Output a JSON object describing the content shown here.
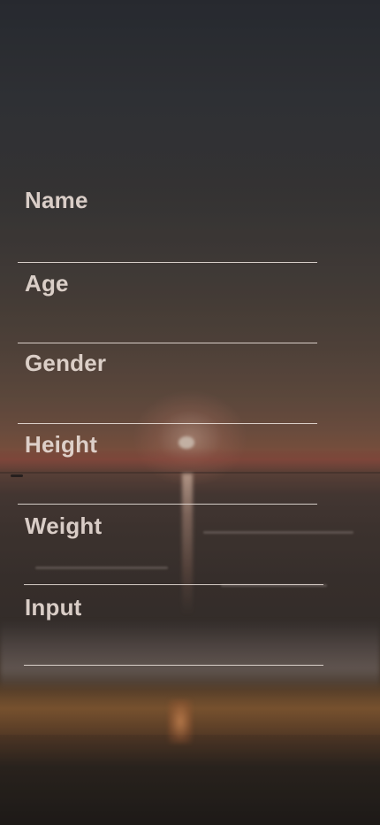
{
  "form": {
    "fields": [
      {
        "label": "Name"
      },
      {
        "label": "Age"
      },
      {
        "label": "Gender"
      },
      {
        "label": "Height"
      },
      {
        "label": "Weight"
      },
      {
        "label": "Input"
      }
    ]
  },
  "colors": {
    "label_text": "#e7dbd4",
    "underline": "#f0e6e1"
  }
}
